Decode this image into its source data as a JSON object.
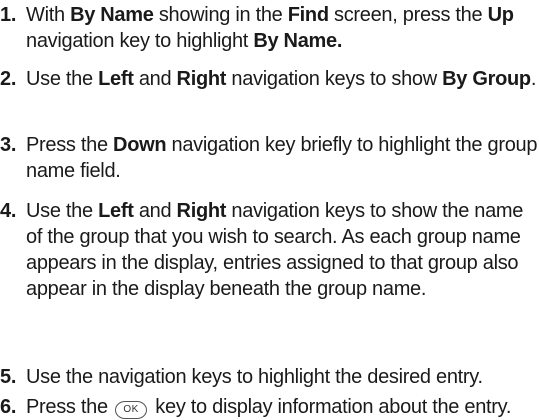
{
  "steps": [
    {
      "num": "1.",
      "parts": [
        {
          "t": "With "
        },
        {
          "t": "By Name",
          "b": true
        },
        {
          "t": " showing in the "
        },
        {
          "t": "Find",
          "b": true
        },
        {
          "t": " screen, press the "
        },
        {
          "t": "Up",
          "b": true
        },
        {
          "t": " navigation key to highlight "
        },
        {
          "t": "By Name.",
          "b": true
        }
      ]
    },
    {
      "num": "2.",
      "parts": [
        {
          "t": "Use the "
        },
        {
          "t": "Left",
          "b": true
        },
        {
          "t": " and "
        },
        {
          "t": "Right",
          "b": true
        },
        {
          "t": " navigation keys to show "
        },
        {
          "t": "By Group",
          "b": true
        },
        {
          "t": "."
        }
      ]
    },
    {
      "num": "3.",
      "parts": [
        {
          "t": "Press the "
        },
        {
          "t": "Down",
          "b": true
        },
        {
          "t": " navigation key briefly to highlight the group name field."
        }
      ]
    },
    {
      "num": "4.",
      "parts": [
        {
          "t": "Use the "
        },
        {
          "t": "Left",
          "b": true
        },
        {
          "t": " and "
        },
        {
          "t": "Right",
          "b": true
        },
        {
          "t": " navigation keys to show the name of the group that you wish to search. As each group name appears in the display, entries assigned to that group also appear in the display beneath the group name."
        }
      ]
    },
    {
      "num": "5.",
      "parts": [
        {
          "t": "Use the navigation keys to highlight the desired entry."
        }
      ]
    },
    {
      "num": "6.",
      "parts": [
        {
          "t": "Press the "
        },
        {
          "key": "OK",
          "icon": "ok-key-icon"
        },
        {
          "t": " key to display information about the entry."
        }
      ]
    }
  ]
}
